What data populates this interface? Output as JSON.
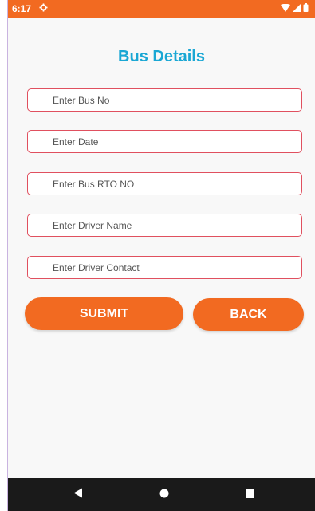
{
  "status_bar": {
    "time": "6:17",
    "settings_icon": "gear-icon",
    "wifi_icon": "wifi-icon",
    "signal_icon": "cell-signal-icon",
    "battery_icon": "battery-icon"
  },
  "page": {
    "title": "Bus Details"
  },
  "form": {
    "bus_no_placeholder": "Enter Bus No",
    "date_placeholder": "Enter Date",
    "rto_no_placeholder": "Enter Bus RTO NO",
    "driver_name_placeholder": "Enter Driver Name",
    "driver_contact_placeholder": "Enter Driver Contact"
  },
  "buttons": {
    "submit_label": "SUBMIT",
    "back_label": "BACK"
  },
  "nav_bar": {
    "back_icon": "triangle-back-icon",
    "home_icon": "circle-home-icon",
    "recents_icon": "square-recents-icon"
  },
  "colors": {
    "accent": "#f26a21",
    "title": "#1aa7d4",
    "field_border": "#e0505f",
    "nav_bar": "#1a1a1a"
  }
}
